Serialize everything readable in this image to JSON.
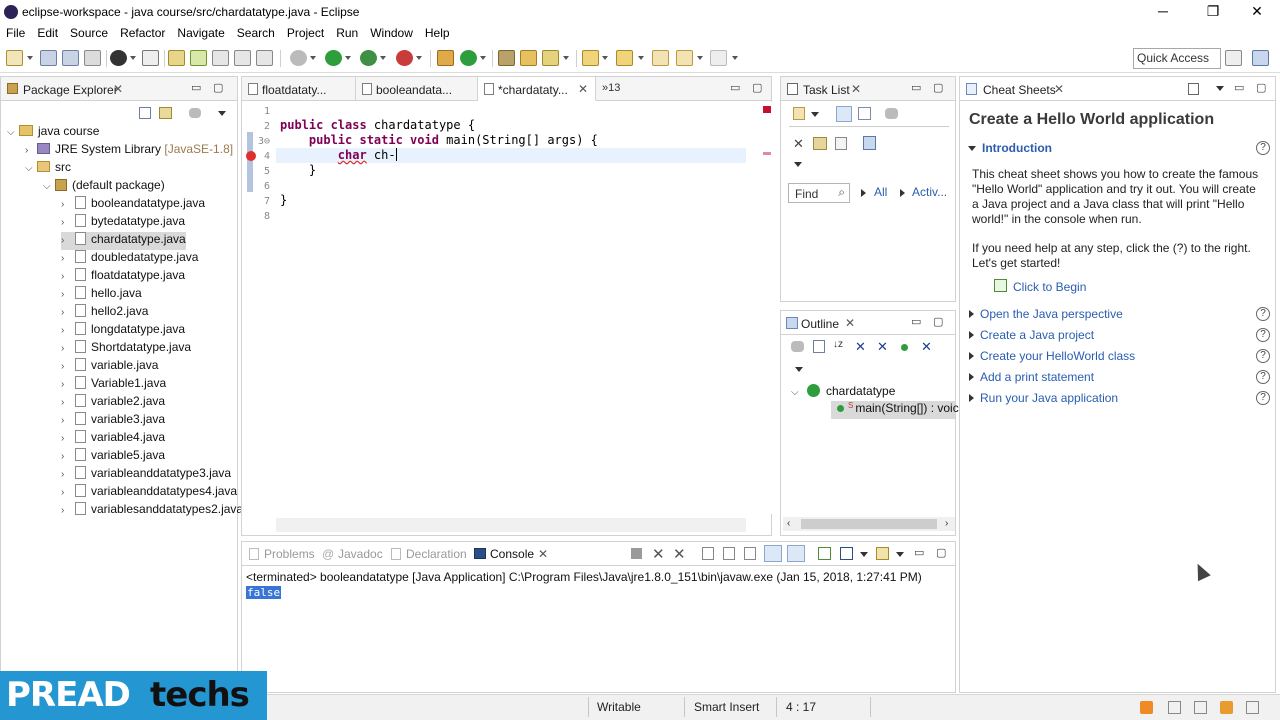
{
  "window": {
    "title": "eclipse-workspace - java course/src/chardatatype.java - Eclipse",
    "minimize": "─",
    "restore": "❐",
    "close": "✕"
  },
  "menu": [
    "File",
    "Edit",
    "Source",
    "Refactor",
    "Navigate",
    "Search",
    "Project",
    "Run",
    "Window",
    "Help"
  ],
  "toolbar": {
    "quick_access_placeholder": "Quick Access"
  },
  "package_explorer": {
    "title": "Package Explorer",
    "project": "java course",
    "jre": "JRE System Library",
    "jre_version": "[JavaSE-1.8]",
    "src": "src",
    "package": "(default package)",
    "files": [
      "booleandatatype.java",
      "bytedatatype.java",
      "chardatatype.java",
      "doubledatatype.java",
      "floatdatatype.java",
      "hello.java",
      "hello2.java",
      "longdatatype.java",
      "Shortdatatype.java",
      "variable.java",
      "Variable1.java",
      "variable2.java",
      "variable3.java",
      "variable4.java",
      "variable5.java",
      "variableanddatatype3.java",
      "variableanddatatypes4.java",
      "variablesanddatatypes2.java"
    ],
    "selected_file": "chardatatype.java"
  },
  "editor": {
    "tabs": [
      "floatdataty...",
      "booleandata...",
      "*chardataty..."
    ],
    "overflow": "»13",
    "line_numbers": [
      "1",
      "2",
      "3⊖",
      "4",
      "5",
      "6",
      "7",
      "8"
    ],
    "code": {
      "l2_kw": "public class",
      "l2_rest": " chardatatype {",
      "l3_kw": "public static void",
      "l3_rest": " main(String[] args) {",
      "l4_kw": "char",
      "l4_rest": " ch-",
      "l5": "}",
      "l7": "}"
    }
  },
  "task_list": {
    "title": "Task List",
    "find_placeholder": "Find",
    "all": "All",
    "activate": "Activ..."
  },
  "outline": {
    "title": "Outline",
    "class_name": "chardatatype",
    "method": "main(String[]) : voic"
  },
  "cheat_sheets": {
    "title": "Cheat Sheets",
    "heading": "Create a Hello World application",
    "intro_label": "Introduction",
    "intro_text": "This cheat sheet shows you how to create the famous \"Hello World\" application and try it out. You will create a Java project and a Java class that will print \"Hello world!\" in the console when run.",
    "help_text": "If you need help at any step, click the (?) to the right. Let's get started!",
    "click_to_begin": "Click to Begin",
    "steps": [
      "Open the Java perspective",
      "Create a Java project",
      "Create your HelloWorld class",
      "Add a print statement",
      "Run your Java application"
    ],
    "help_glyph": "?"
  },
  "console": {
    "tabs": [
      "Problems",
      "Javadoc",
      "Declaration",
      "Console"
    ],
    "terminated": "<terminated> booleandatatype [Java Application] C:\\Program Files\\Java\\jre1.8.0_151\\bin\\javaw.exe (Jan 15, 2018, 1:27:41 PM)",
    "output": "false"
  },
  "status_bar": {
    "writable": "Writable",
    "insert_mode": "Smart Insert",
    "position": "4 : 17"
  },
  "watermark": {
    "part1": "PREAD",
    "part2": "techs"
  },
  "colors": {
    "accent": "#2a5db0",
    "keyword": "#7f0055",
    "error": "#e0302c",
    "brand": "#2496d1"
  }
}
